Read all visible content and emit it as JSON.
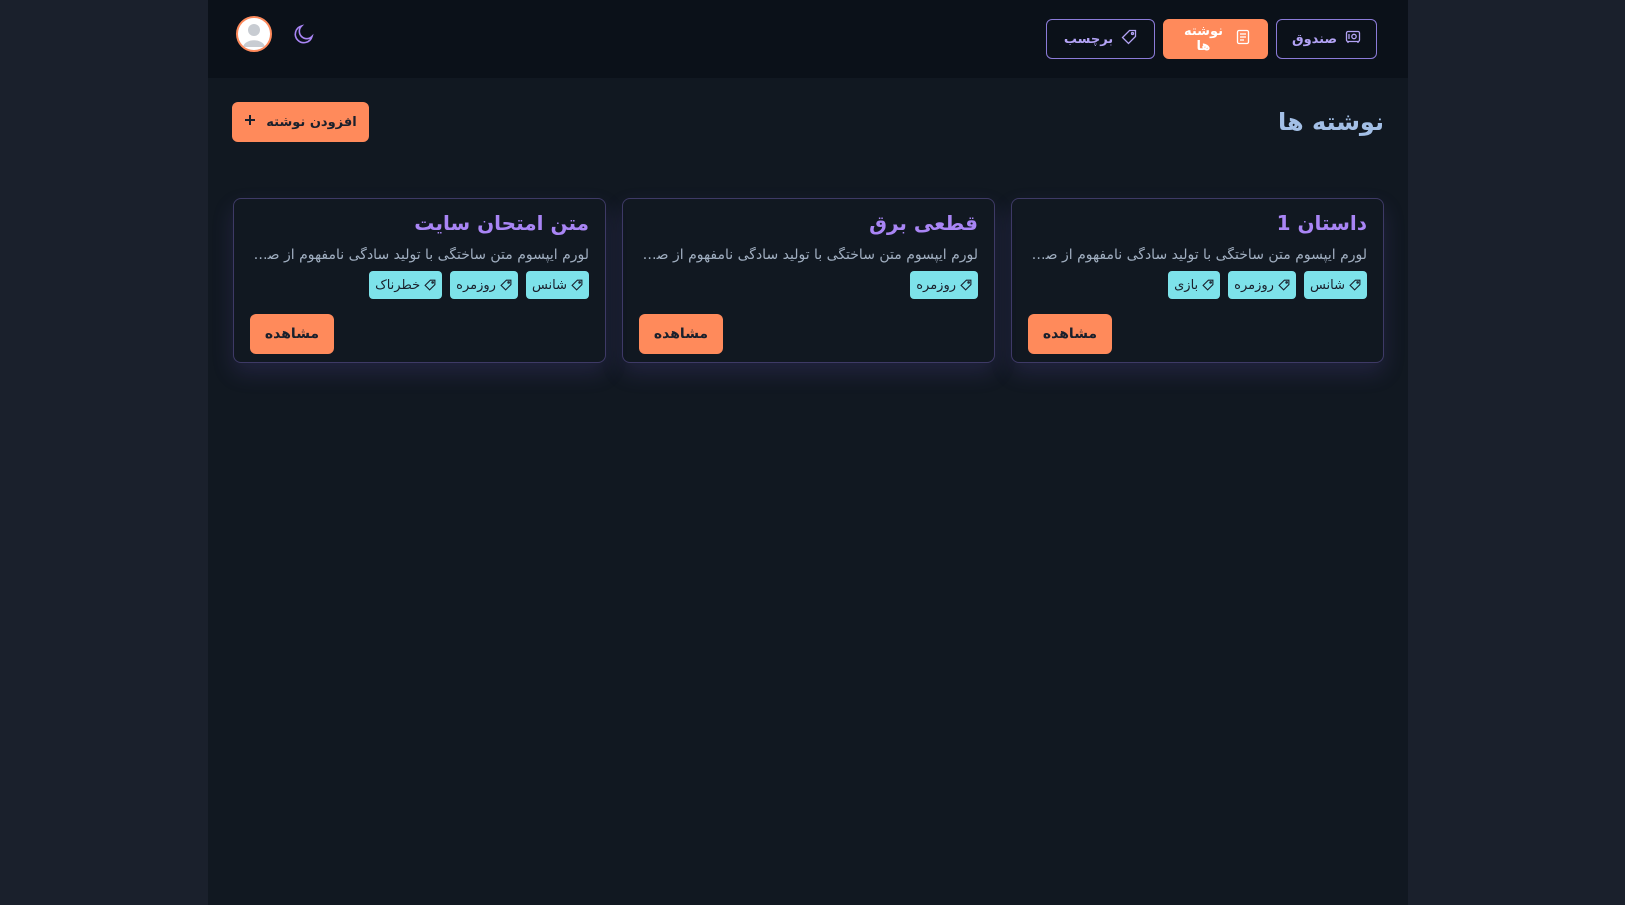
{
  "nav": {
    "items": [
      {
        "label": "صندوق",
        "icon": "safe-icon",
        "active": false
      },
      {
        "label": "نوشته ها",
        "icon": "document-icon",
        "active": true
      },
      {
        "label": "برچسب",
        "icon": "tag-icon",
        "active": false
      }
    ]
  },
  "header": {
    "title": "نوشته ها",
    "add_label": "افزودن نوشته"
  },
  "cards": [
    {
      "title": "داستان 1",
      "text": "لورم ایپسوم متن ساختگی با تولید سادگی نامفهوم از صنعت چاپ و با استفاده از طراحان گرافیک است",
      "tags": [
        "شانس",
        "روزمره",
        "بازی"
      ],
      "view_label": "مشاهده"
    },
    {
      "title": "قطعی برق",
      "text": "لورم ایپسوم متن ساختگی با تولید سادگی نامفهوم از صنعت چاپ و با استفاده از طراحان گرافیک است",
      "tags": [
        "روزمره"
      ],
      "view_label": "مشاهده"
    },
    {
      "title": "متن امتحان سایت",
      "text": "لورم ایپسوم متن ساختگی با تولید سادگی نامفهوم از صنعت چاپ و با استفاده از طراحان گرافیک است",
      "tags": [
        "شانس",
        "روزمره",
        "خطرناک"
      ],
      "view_label": "مشاهده"
    }
  ],
  "colors": {
    "accent": "#ff8a5b",
    "purple": "#a985f5",
    "tag_bg": "#7de2ea",
    "background": "#111821"
  }
}
